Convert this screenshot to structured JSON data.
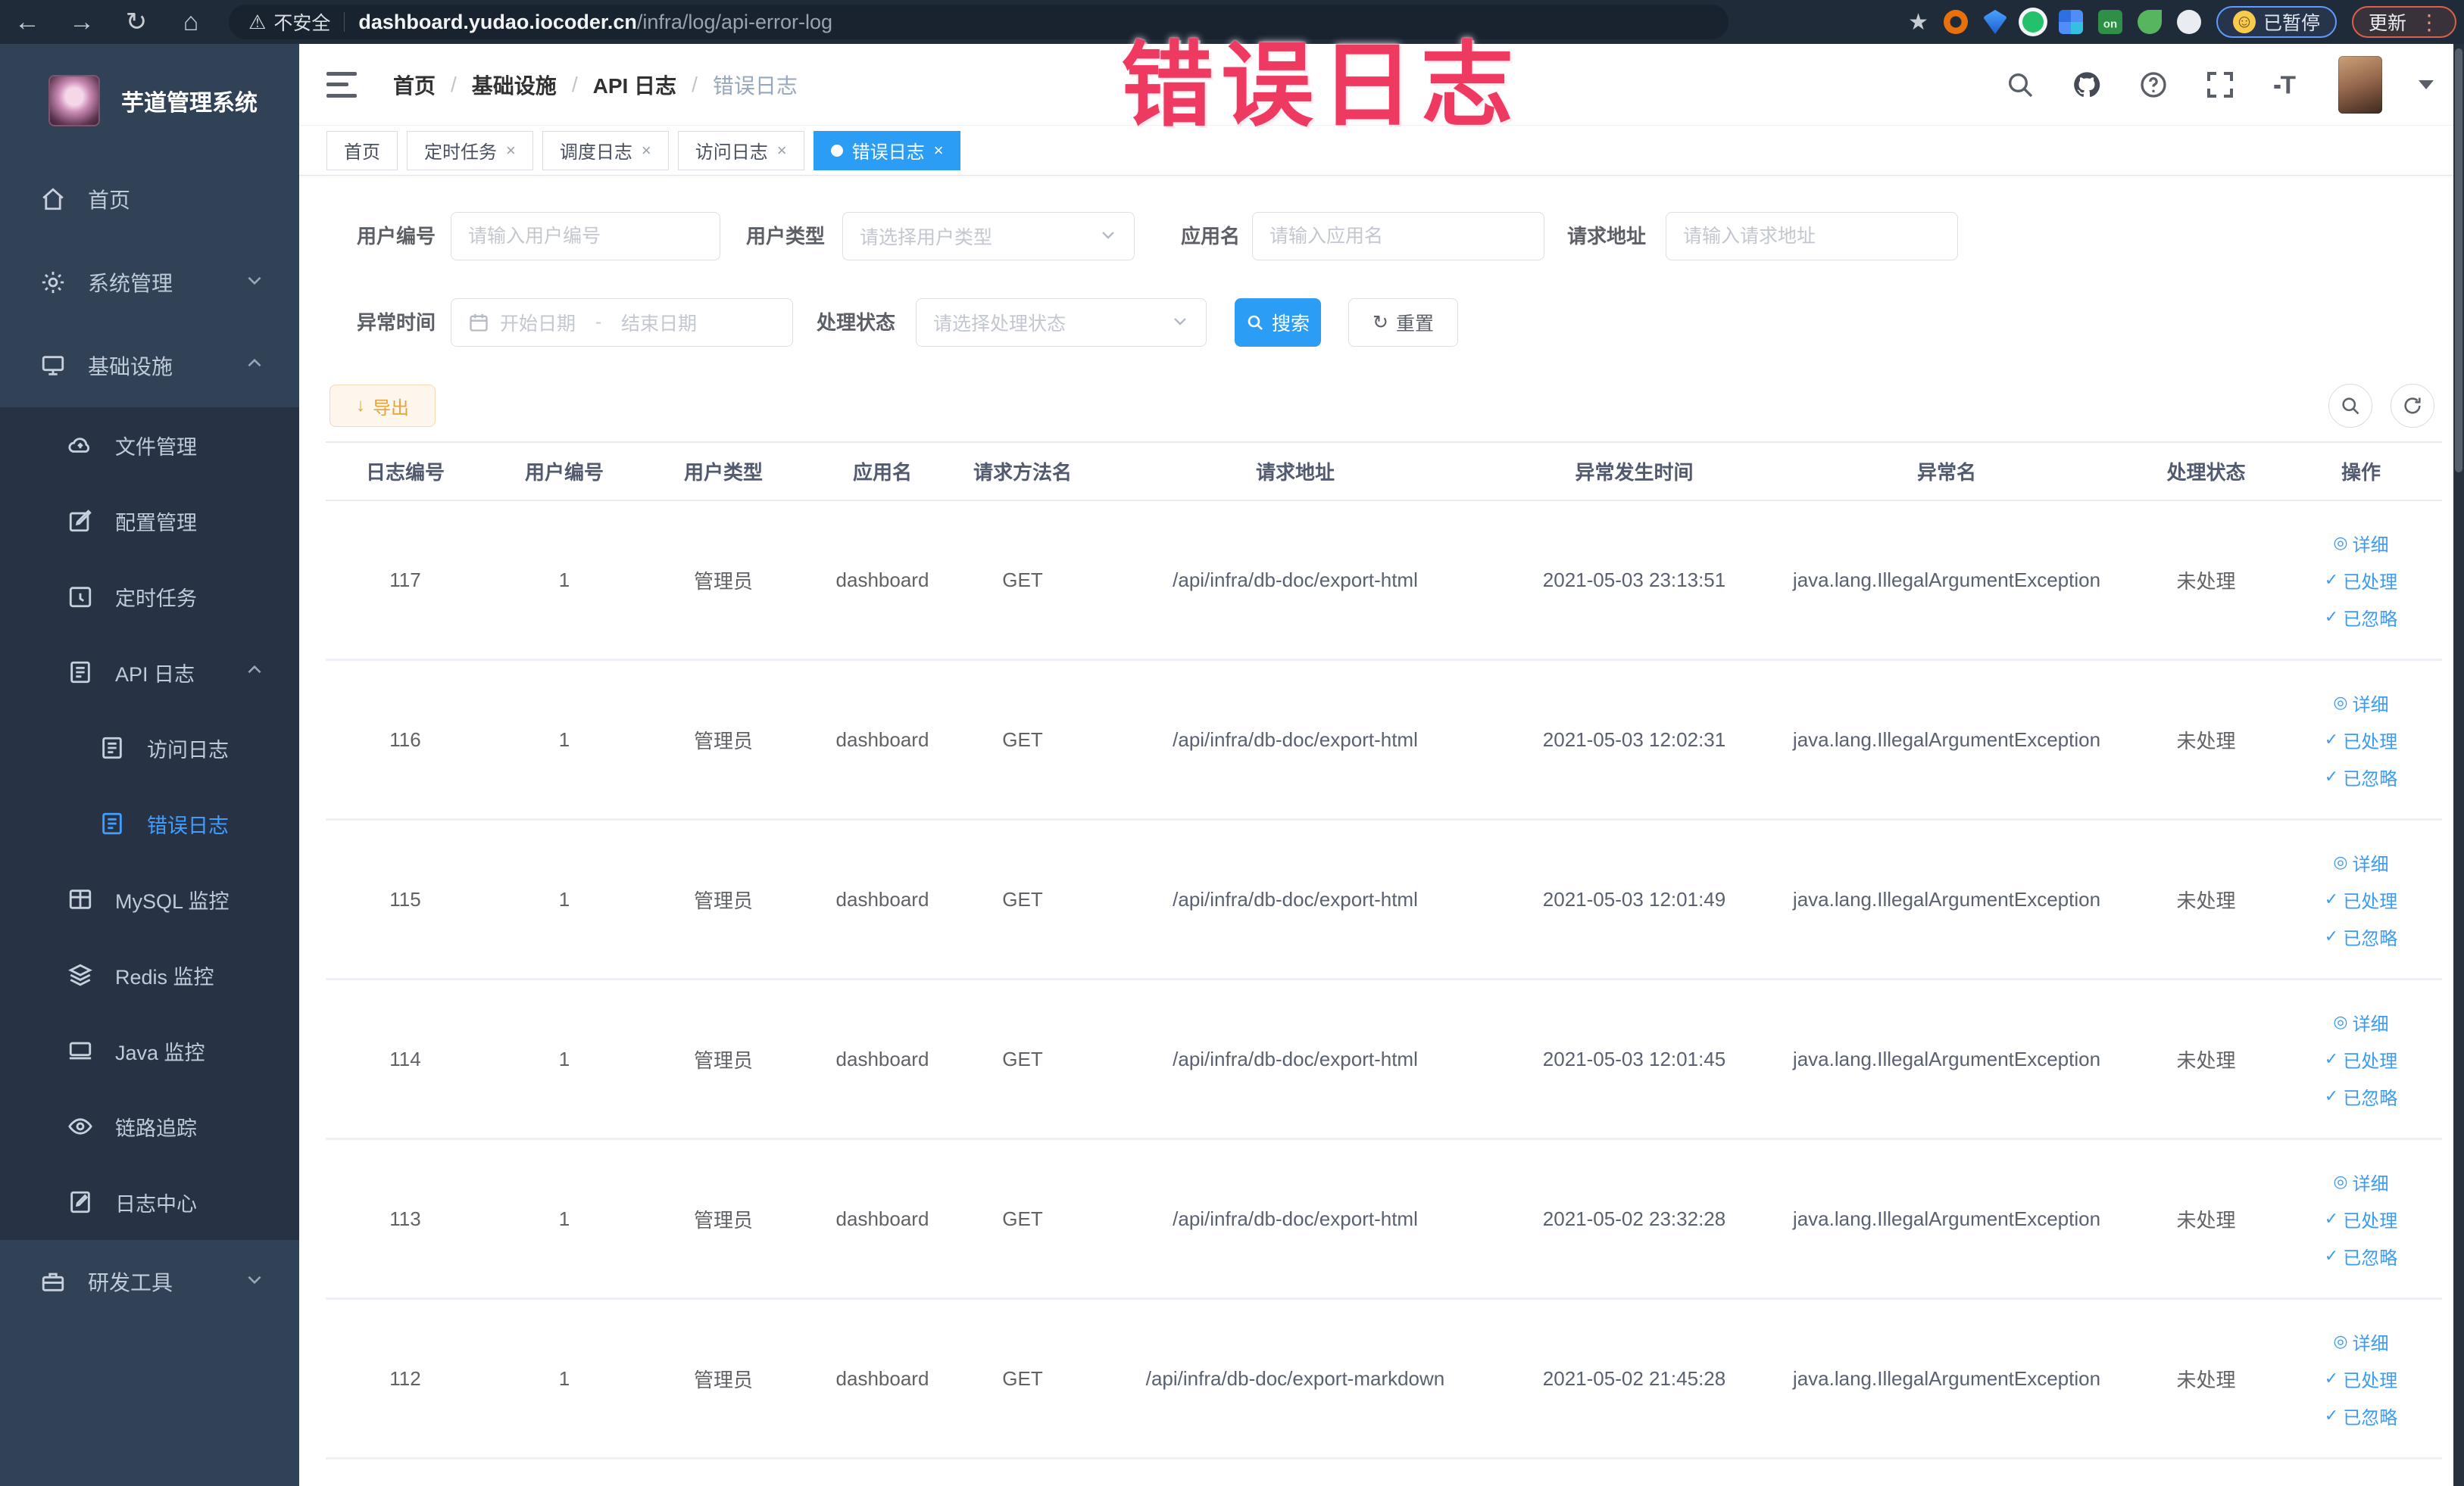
{
  "browser": {
    "back_glyph": "←",
    "forward_glyph": "→",
    "reload_glyph": "↻",
    "home_glyph": "⌂",
    "warning_glyph": "⚠",
    "insecure_label": "不安全",
    "url_host": "dashboard.yudao.iocoder.cn",
    "url_path": "/infra/log/api-error-log",
    "star_glyph": "★",
    "paused_face_glyph": "☺",
    "paused_label": "已暂停",
    "update_label": "更新",
    "menu_dots_glyph": "⋮"
  },
  "annotation": {
    "text": "错误日志",
    "color": "#ee3a60"
  },
  "sidebar": {
    "title": "芋道管理系统",
    "items": [
      {
        "key": "home",
        "label": "首页",
        "icon": "home",
        "level": 1,
        "chevron": null,
        "active": false
      },
      {
        "key": "system-mgmt",
        "label": "系统管理",
        "icon": "gear",
        "level": 1,
        "chevron": "down",
        "active": false
      },
      {
        "key": "infrastructure",
        "label": "基础设施",
        "icon": "monitor",
        "level": 1,
        "chevron": "up",
        "active": false
      },
      {
        "key": "file-mgmt",
        "label": "文件管理",
        "icon": "cloud",
        "level": 2,
        "chevron": null,
        "active": false
      },
      {
        "key": "config-mgmt",
        "label": "配置管理",
        "icon": "edit",
        "level": 2,
        "chevron": null,
        "active": false
      },
      {
        "key": "scheduled-jobs",
        "label": "定时任务",
        "icon": "timer",
        "level": 2,
        "chevron": null,
        "active": false
      },
      {
        "key": "api-log",
        "label": "API 日志",
        "icon": "doc",
        "level": 2,
        "chevron": "up",
        "active": false
      },
      {
        "key": "access-log",
        "label": "访问日志",
        "icon": "doc",
        "level": 3,
        "chevron": null,
        "active": false
      },
      {
        "key": "error-log",
        "label": "错误日志",
        "icon": "doc",
        "level": 3,
        "chevron": null,
        "active": true
      },
      {
        "key": "mysql-monitor",
        "label": "MySQL 监控",
        "icon": "grid",
        "level": 2,
        "chevron": null,
        "active": false
      },
      {
        "key": "redis-monitor",
        "label": "Redis 监控",
        "icon": "layers",
        "level": 2,
        "chevron": null,
        "active": false
      },
      {
        "key": "java-monitor",
        "label": "Java 监控",
        "icon": "computer",
        "level": 2,
        "chevron": null,
        "active": false
      },
      {
        "key": "trace",
        "label": "链路追踪",
        "icon": "eye",
        "level": 2,
        "chevron": null,
        "active": false
      },
      {
        "key": "log-center",
        "label": "日志中心",
        "icon": "doc-edit",
        "level": 2,
        "chevron": null,
        "active": false
      },
      {
        "key": "dev-tools",
        "label": "研发工具",
        "icon": "toolbox",
        "level": 1,
        "chevron": "down",
        "active": false
      }
    ]
  },
  "header": {
    "breadcrumb": [
      "首页",
      "基础设施",
      "API 日志",
      "错误日志"
    ],
    "separator": "/"
  },
  "tabs": [
    {
      "key": "home",
      "label": "首页",
      "closable": false,
      "active": false
    },
    {
      "key": "scheduled-jobs",
      "label": "定时任务",
      "closable": true,
      "active": false
    },
    {
      "key": "schedule-log",
      "label": "调度日志",
      "closable": true,
      "active": false
    },
    {
      "key": "access-log",
      "label": "访问日志",
      "closable": true,
      "active": false
    },
    {
      "key": "error-log",
      "label": "错误日志",
      "closable": true,
      "active": true
    }
  ],
  "filters": {
    "user_id": {
      "label": "用户编号",
      "placeholder": "请输入用户编号"
    },
    "user_type": {
      "label": "用户类型",
      "placeholder": "请选择用户类型"
    },
    "app_name": {
      "label": "应用名",
      "placeholder": "请输入应用名"
    },
    "request_url": {
      "label": "请求地址",
      "placeholder": "请输入请求地址"
    },
    "exception_time": {
      "label": "异常时间",
      "start_placeholder": "开始日期",
      "range_separator": "-",
      "end_placeholder": "结束日期"
    },
    "process_status": {
      "label": "处理状态",
      "placeholder": "请选择处理状态"
    }
  },
  "toolbar": {
    "search_label": "搜索",
    "reset_label": "重置",
    "reset_glyph": "↻",
    "export_label": "导出",
    "export_glyph": "↓"
  },
  "table": {
    "headers": [
      "日志编号",
      "用户编号",
      "用户类型",
      "应用名",
      "请求方法名",
      "请求地址",
      "异常发生时间",
      "异常名",
      "处理状态",
      "操作"
    ],
    "row_actions": [
      {
        "key": "detail",
        "label": "详细",
        "glyph": "◎"
      },
      {
        "key": "done",
        "label": "已处理",
        "glyph": "✓"
      },
      {
        "key": "ignored",
        "label": "已忽略",
        "glyph": "✓"
      }
    ],
    "rows": [
      {
        "log_id": "117",
        "user_id": "1",
        "user_type": "管理员",
        "app_name": "dashboard",
        "method": "GET",
        "url": "/api/infra/db-doc/export-html",
        "time": "2021-05-03 23:13:51",
        "exception": "java.lang.IllegalArgumentException",
        "status": "未处理"
      },
      {
        "log_id": "116",
        "user_id": "1",
        "user_type": "管理员",
        "app_name": "dashboard",
        "method": "GET",
        "url": "/api/infra/db-doc/export-html",
        "time": "2021-05-03 12:02:31",
        "exception": "java.lang.IllegalArgumentException",
        "status": "未处理"
      },
      {
        "log_id": "115",
        "user_id": "1",
        "user_type": "管理员",
        "app_name": "dashboard",
        "method": "GET",
        "url": "/api/infra/db-doc/export-html",
        "time": "2021-05-03 12:01:49",
        "exception": "java.lang.IllegalArgumentException",
        "status": "未处理"
      },
      {
        "log_id": "114",
        "user_id": "1",
        "user_type": "管理员",
        "app_name": "dashboard",
        "method": "GET",
        "url": "/api/infra/db-doc/export-html",
        "time": "2021-05-03 12:01:45",
        "exception": "java.lang.IllegalArgumentException",
        "status": "未处理"
      },
      {
        "log_id": "113",
        "user_id": "1",
        "user_type": "管理员",
        "app_name": "dashboard",
        "method": "GET",
        "url": "/api/infra/db-doc/export-html",
        "time": "2021-05-02 23:32:28",
        "exception": "java.lang.IllegalArgumentException",
        "status": "未处理"
      },
      {
        "log_id": "112",
        "user_id": "1",
        "user_type": "管理员",
        "app_name": "dashboard",
        "method": "GET",
        "url": "/api/infra/db-doc/export-markdown",
        "time": "2021-05-02 21:45:28",
        "exception": "java.lang.IllegalArgumentException",
        "status": "未处理"
      }
    ]
  },
  "colors": {
    "accent_blue": "#409eff",
    "active_tab": "#2b9df4",
    "export_warning": "#e6a23c",
    "annotation_pink": "#ee3a60"
  }
}
